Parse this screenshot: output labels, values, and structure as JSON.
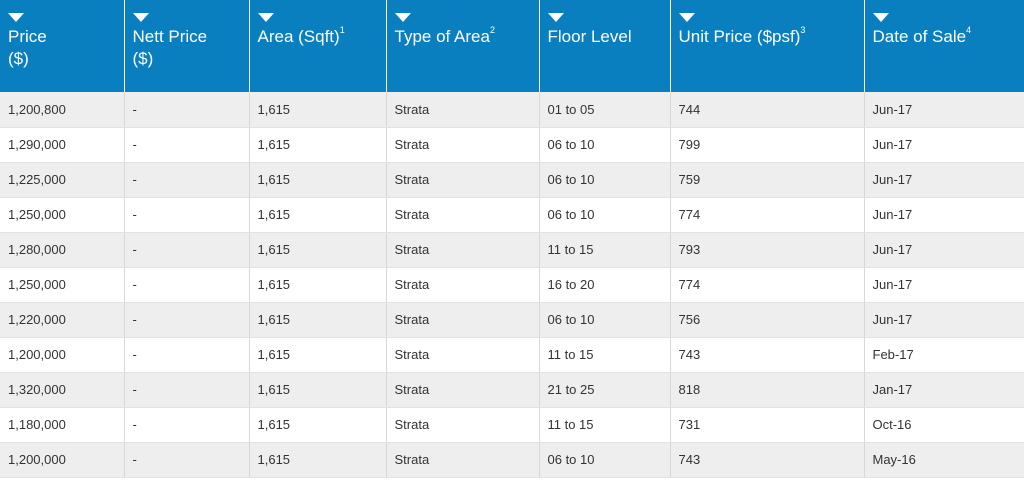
{
  "headers": [
    {
      "line1": "Price",
      "line2": "($)",
      "sup": ""
    },
    {
      "line1": "Nett Price",
      "line2": "($)",
      "sup": ""
    },
    {
      "line1": "Area (Sqft)",
      "line2": "",
      "sup": "1"
    },
    {
      "line1": "Type of Area",
      "line2": "",
      "sup": "2"
    },
    {
      "line1": "Floor Level",
      "line2": "",
      "sup": ""
    },
    {
      "line1": "Unit Price ($psf)",
      "line2": "",
      "sup": "3"
    },
    {
      "line1": "Date of Sale",
      "line2": "",
      "sup": "4"
    }
  ],
  "rows": [
    [
      "1,200,800",
      "-",
      "1,615",
      "Strata",
      "01 to 05",
      "744",
      "Jun-17"
    ],
    [
      "1,290,000",
      "-",
      "1,615",
      "Strata",
      "06 to 10",
      "799",
      "Jun-17"
    ],
    [
      "1,225,000",
      "-",
      "1,615",
      "Strata",
      "06 to 10",
      "759",
      "Jun-17"
    ],
    [
      "1,250,000",
      "-",
      "1,615",
      "Strata",
      "06 to 10",
      "774",
      "Jun-17"
    ],
    [
      "1,280,000",
      "-",
      "1,615",
      "Strata",
      "11 to 15",
      "793",
      "Jun-17"
    ],
    [
      "1,250,000",
      "-",
      "1,615",
      "Strata",
      "16 to 20",
      "774",
      "Jun-17"
    ],
    [
      "1,220,000",
      "-",
      "1,615",
      "Strata",
      "06 to 10",
      "756",
      "Jun-17"
    ],
    [
      "1,200,000",
      "-",
      "1,615",
      "Strata",
      "11 to 15",
      "743",
      "Feb-17"
    ],
    [
      "1,320,000",
      "-",
      "1,615",
      "Strata",
      "21 to 25",
      "818",
      "Jan-17"
    ],
    [
      "1,180,000",
      "-",
      "1,615",
      "Strata",
      "11 to 15",
      "731",
      "Oct-16"
    ],
    [
      "1,200,000",
      "-",
      "1,615",
      "Strata",
      "06 to 10",
      "743",
      "May-16"
    ]
  ],
  "colors": {
    "header_bg": "#0a7fc0",
    "header_text": "#ffffff",
    "row_odd": "#eeeeee",
    "row_even": "#ffffff"
  },
  "icons": {
    "sort": "caret-down-icon"
  }
}
